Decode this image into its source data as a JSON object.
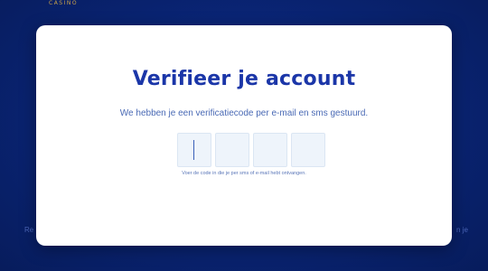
{
  "background": {
    "logo_text": "CASINO",
    "left_text": "Re",
    "right_text": "n je"
  },
  "modal": {
    "title": "Verifieer je account",
    "subtitle": "We hebben je een verificatiecode per e-mail en sms gestuurd.",
    "code_inputs": [
      {
        "value": "",
        "focused": true
      },
      {
        "value": "",
        "focused": false
      },
      {
        "value": "",
        "focused": false
      },
      {
        "value": "",
        "focused": false
      }
    ],
    "hint": "Voer de code in die je per sms of e-mail hebt ontvangen."
  },
  "colors": {
    "background": "#0a2577",
    "title": "#1b36a8",
    "subtitle": "#4a6ab5",
    "input_fill": "#eef4fb"
  }
}
